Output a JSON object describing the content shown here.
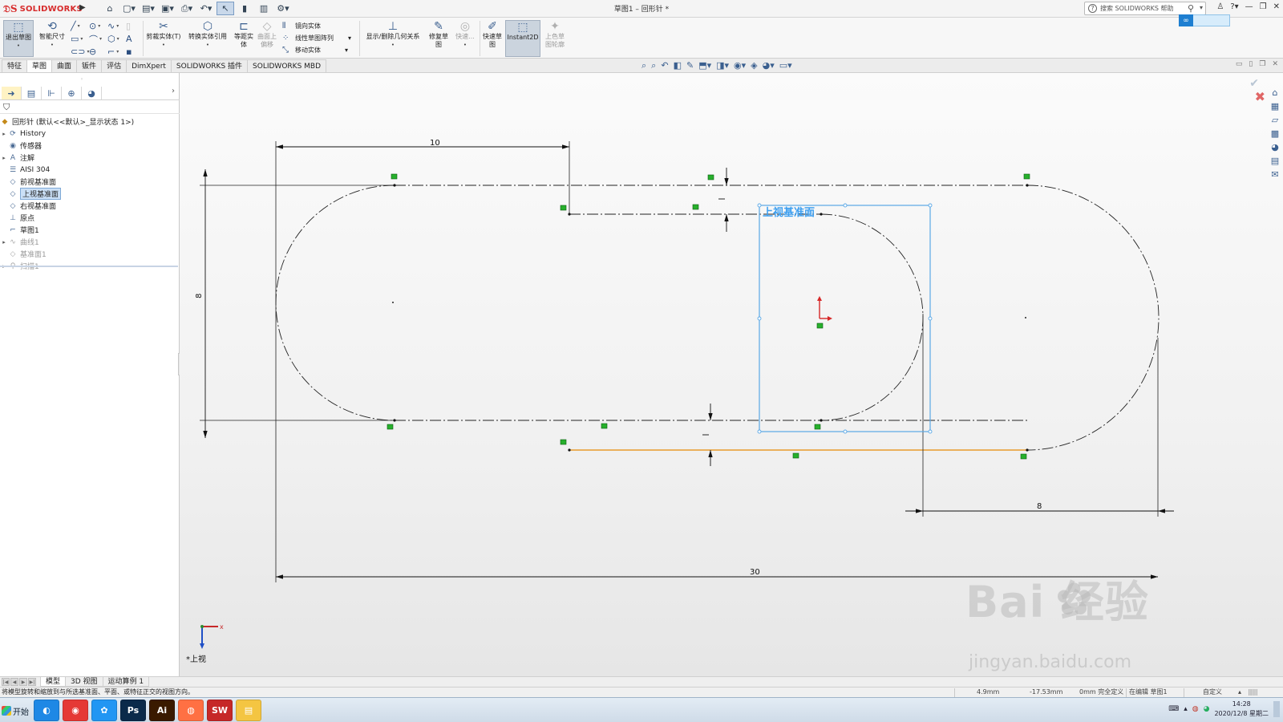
{
  "titlebar": {
    "logo_text": "SOLIDWORKS",
    "window_title": "草图1 – 回形针 *",
    "search_placeholder": "搜索 SOLIDWORKS 帮助"
  },
  "ribbon": {
    "exit_sketch": "退出草图",
    "smart_dim": "智能尺寸",
    "trim": "剪裁实体(T)",
    "convert": "转换实体引用",
    "offset": "等距实体",
    "surface_offset": "曲面上偏移",
    "mirror": "镜向实体",
    "linear_pattern": "线性草图阵列",
    "move": "移动实体",
    "relations": "显示/删除几何关系",
    "repair": "修复草图",
    "quick_snap": "快速...",
    "rapid_sketch": "快速草图",
    "instant2d": "Instant2D",
    "shaded_contours": "上色草图轮廓"
  },
  "command_tabs": [
    "特征",
    "草图",
    "曲面",
    "钣件",
    "评估",
    "DimXpert",
    "SOLIDWORKS 插件",
    "SOLIDWORKS MBD"
  ],
  "active_command_tab": "草图",
  "tree": {
    "root": "回形针 (默认<<默认>_显示状态 1>)",
    "items": [
      {
        "label": "History",
        "icon": "history-icon",
        "expand": "▸"
      },
      {
        "label": "传感器",
        "icon": "sensor-icon",
        "expand": ""
      },
      {
        "label": "注解",
        "icon": "annotation-icon",
        "expand": "▸"
      },
      {
        "label": "AISI 304",
        "icon": "material-icon",
        "expand": ""
      },
      {
        "label": "前视基准面",
        "icon": "plane-icon",
        "expand": ""
      },
      {
        "label": "上视基准面",
        "icon": "plane-icon",
        "expand": "",
        "selected": true
      },
      {
        "label": "右视基准面",
        "icon": "plane-icon",
        "expand": ""
      },
      {
        "label": "原点",
        "icon": "origin-icon",
        "expand": ""
      },
      {
        "label": "草图1",
        "icon": "sketch-icon",
        "expand": ""
      },
      {
        "label": "曲线1",
        "icon": "curve-icon",
        "expand": "▸",
        "dim": true
      },
      {
        "label": "基准面1",
        "icon": "plane-icon",
        "expand": "",
        "dim": true
      },
      {
        "label": "扫描1",
        "icon": "sweep-icon",
        "expand": "▸",
        "dim": true
      }
    ]
  },
  "drawing": {
    "dim_top": "10",
    "dim_left": "8",
    "dim_right": "8",
    "dim_bottom": "30",
    "plane_label": "上视基准面",
    "view_label": "*上视",
    "triad_x": "x"
  },
  "watermark": {
    "main": "Bai  经验",
    "sub": "jingyan.baidu.com"
  },
  "bottom_tabs": [
    "模型",
    "3D 视图",
    "运动算例 1"
  ],
  "active_bottom_tab": "模型",
  "status": {
    "message": "将模型旋转和缩放到与所选基准面、平面、或特征正交的视图方向。",
    "x": "4.9mm",
    "y": "-17.53mm",
    "z": "0mm 完全定义",
    "mode": "在编辑 草图1",
    "units": "自定义"
  },
  "taskbar": {
    "start": "开始",
    "apps": [
      {
        "name": "browser-app",
        "label": "◐",
        "color": "#1e88e5"
      },
      {
        "name": "chrome-app",
        "label": "◉",
        "color": "#e53935"
      },
      {
        "name": "baidu-app",
        "label": "✿",
        "color": "#2196f3"
      },
      {
        "name": "photoshop-app",
        "label": "Ps",
        "color": "#0b2a4a"
      },
      {
        "name": "illustrator-app",
        "label": "Ai",
        "color": "#3a1a00"
      },
      {
        "name": "firefox-app",
        "label": "◍",
        "color": "#ff7043"
      },
      {
        "name": "solidworks-app",
        "label": "SW",
        "color": "#c62828"
      },
      {
        "name": "explorer-app",
        "label": "▤",
        "color": "#f4c542"
      }
    ],
    "time": "14:28",
    "date": "2020/12/8 星期二"
  }
}
